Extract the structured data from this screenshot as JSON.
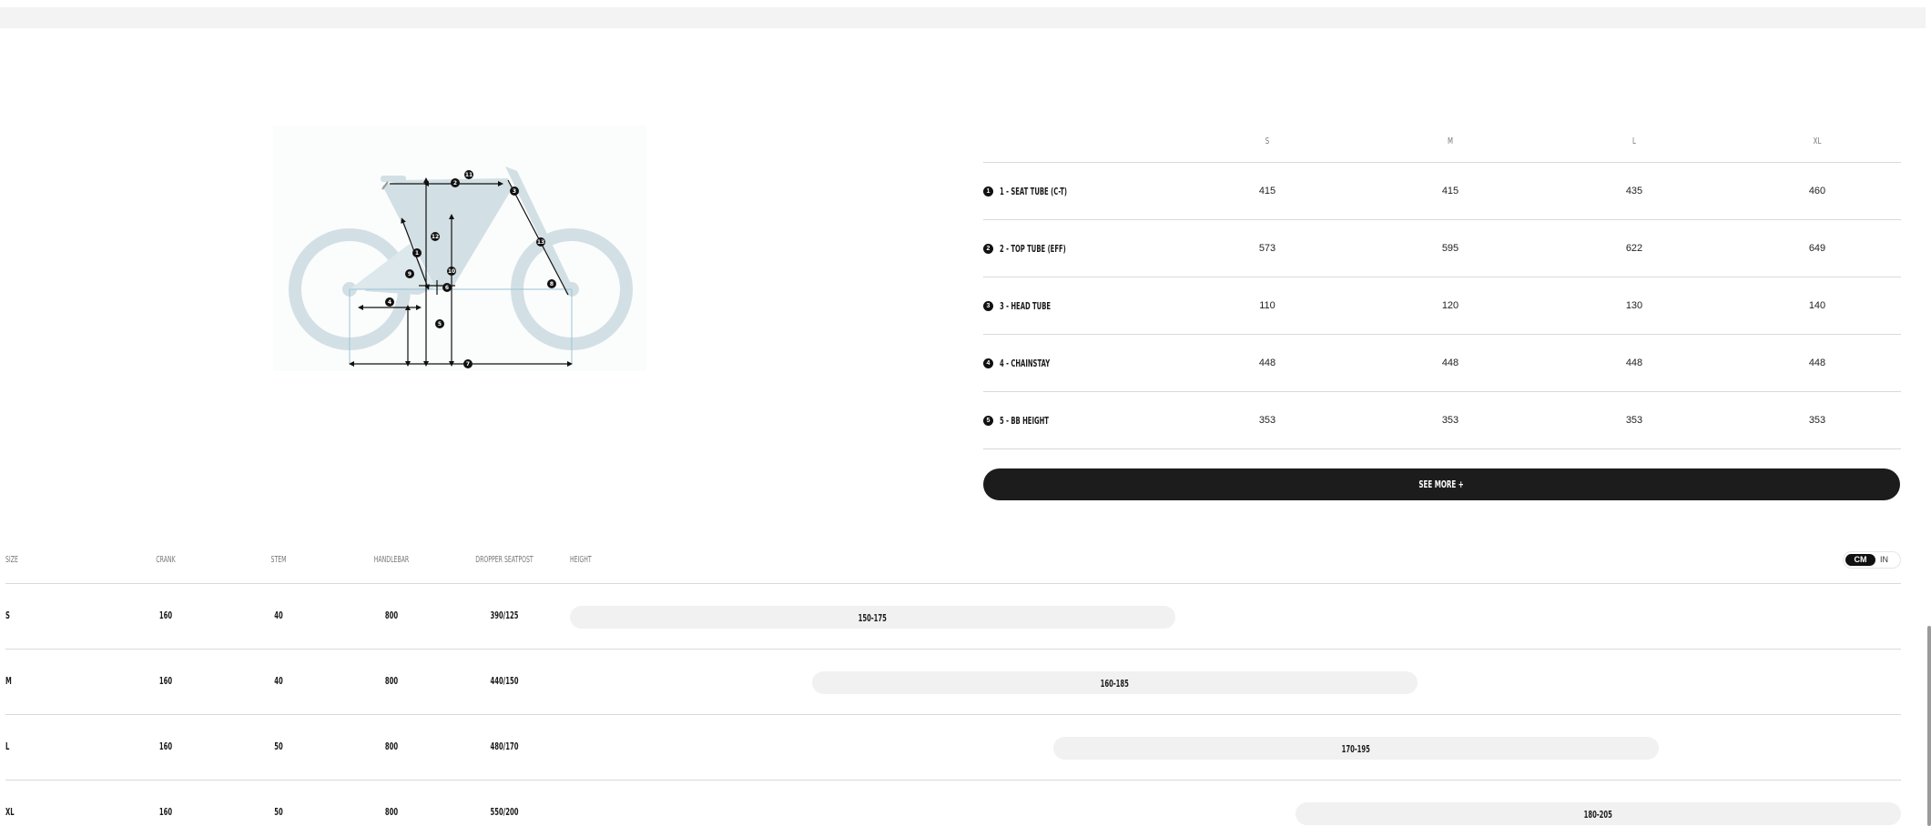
{
  "geometry": {
    "sizes": [
      "S",
      "M",
      "L",
      "XL"
    ],
    "rows": [
      {
        "num": "1",
        "label": "1 - SEAT TUBE (C-T)",
        "values": [
          "415",
          "415",
          "435",
          "460"
        ]
      },
      {
        "num": "2",
        "label": "2 - TOP TUBE (EFF)",
        "values": [
          "573",
          "595",
          "622",
          "649"
        ]
      },
      {
        "num": "3",
        "label": "3 - HEAD TUBE",
        "values": [
          "110",
          "120",
          "130",
          "140"
        ]
      },
      {
        "num": "4",
        "label": "4 - CHAINSTAY",
        "values": [
          "448",
          "448",
          "448",
          "448"
        ]
      },
      {
        "num": "5",
        "label": "5 - BB HEIGHT",
        "values": [
          "353",
          "353",
          "353",
          "353"
        ]
      }
    ],
    "see_more_label": "SEE MORE +"
  },
  "diagram": {
    "markers": [
      "1",
      "2",
      "3",
      "4",
      "5",
      "6",
      "7",
      "8",
      "9",
      "10",
      "11",
      "12",
      "13"
    ]
  },
  "size_chart": {
    "headers": [
      "SIZE",
      "CRANK",
      "STEM",
      "HANDLEBAR",
      "DROPPER SEATPOST",
      "HEIGHT"
    ],
    "units": {
      "active": "CM",
      "inactive": "IN"
    },
    "rows": [
      {
        "size": "S",
        "crank": "160",
        "stem": "40",
        "handlebar": "800",
        "seatpost": "390/125",
        "height": "150-175"
      },
      {
        "size": "M",
        "crank": "160",
        "stem": "40",
        "handlebar": "800",
        "seatpost": "440/150",
        "height": "160-185"
      },
      {
        "size": "L",
        "crank": "160",
        "stem": "50",
        "handlebar": "800",
        "seatpost": "480/170",
        "height": "170-195"
      },
      {
        "size": "XL",
        "crank": "160",
        "stem": "50",
        "handlebar": "800",
        "seatpost": "550/200",
        "height": "180-205"
      }
    ]
  }
}
